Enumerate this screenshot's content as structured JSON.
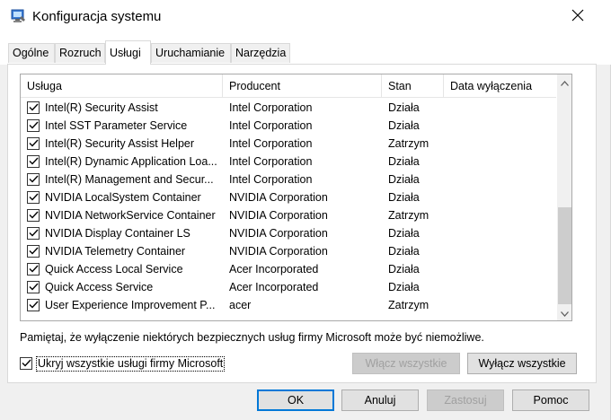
{
  "window": {
    "title": "Konfiguracja systemu"
  },
  "tabs": [
    {
      "label": "Ogólne",
      "active": false
    },
    {
      "label": "Rozruch",
      "active": false
    },
    {
      "label": "Usługi",
      "active": true
    },
    {
      "label": "Uruchamianie",
      "active": false
    },
    {
      "label": "Narzędzia",
      "active": false
    }
  ],
  "services": {
    "columns": [
      "Usługa",
      "Producent",
      "Stan",
      "Data wyłączenia"
    ],
    "rows": [
      {
        "name": "Intel(R) Security Assist",
        "vendor": "Intel Corporation",
        "status": "Działa",
        "disabled_date": "",
        "checked": true
      },
      {
        "name": "Intel SST Parameter Service",
        "vendor": "Intel Corporation",
        "status": "Działa",
        "disabled_date": "",
        "checked": true
      },
      {
        "name": "Intel(R) Security Assist Helper",
        "vendor": "Intel Corporation",
        "status": "Zatrzym",
        "disabled_date": "",
        "checked": true
      },
      {
        "name": "Intel(R) Dynamic Application Loa...",
        "vendor": "Intel Corporation",
        "status": "Działa",
        "disabled_date": "",
        "checked": true
      },
      {
        "name": "Intel(R) Management and Secur...",
        "vendor": "Intel Corporation",
        "status": "Działa",
        "disabled_date": "",
        "checked": true
      },
      {
        "name": "NVIDIA LocalSystem Container",
        "vendor": "NVIDIA Corporation",
        "status": "Działa",
        "disabled_date": "",
        "checked": true
      },
      {
        "name": "NVIDIA NetworkService Container",
        "vendor": "NVIDIA Corporation",
        "status": "Zatrzym",
        "disabled_date": "",
        "checked": true
      },
      {
        "name": "NVIDIA Display Container LS",
        "vendor": "NVIDIA Corporation",
        "status": "Działa",
        "disabled_date": "",
        "checked": true
      },
      {
        "name": "NVIDIA Telemetry Container",
        "vendor": "NVIDIA Corporation",
        "status": "Działa",
        "disabled_date": "",
        "checked": true
      },
      {
        "name": "Quick Access Local Service",
        "vendor": "Acer Incorporated",
        "status": "Działa",
        "disabled_date": "",
        "checked": true
      },
      {
        "name": "Quick Access Service",
        "vendor": "Acer Incorporated",
        "status": "Działa",
        "disabled_date": "",
        "checked": true
      },
      {
        "name": "User Experience Improvement P...",
        "vendor": "acer",
        "status": "Zatrzym",
        "disabled_date": "",
        "checked": true
      }
    ]
  },
  "note": "Pamiętaj, że wyłączenie niektórych bezpiecznych usług firmy Microsoft może być niemożliwe.",
  "hide_ms": {
    "label": "Ukryj wszystkie usługi firmy Microsoft",
    "checked": true
  },
  "buttons": {
    "enable_all": "Włącz wszystkie",
    "disable_all": "Wyłącz wszystkie",
    "ok": "OK",
    "cancel": "Anuluj",
    "apply": "Zastosuj",
    "help": "Pomoc"
  },
  "icons": {
    "app": "msconfig-icon",
    "close": "close-icon",
    "scroll_up": "chevron-up-icon",
    "scroll_down": "chevron-down-icon",
    "check": "checkmark-icon"
  },
  "colors": {
    "accent": "#0078d7"
  }
}
